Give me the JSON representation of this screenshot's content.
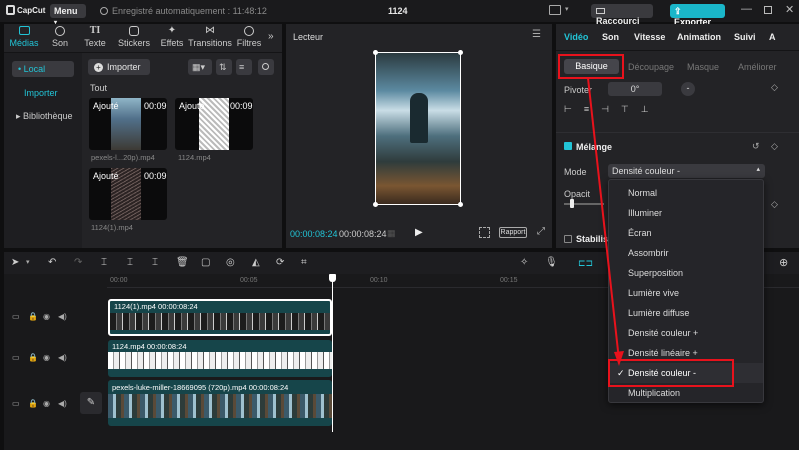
{
  "titlebar": {
    "logo": "CapCut",
    "menu": "Menu",
    "autosave": "Enregistré automatiquement : 11:48:12",
    "project": "1124",
    "shortcuts": "Raccourci",
    "export": "Exporter"
  },
  "media_tabs": [
    {
      "label": "Médias",
      "icon": "media-icon",
      "active": true
    },
    {
      "label": "Son",
      "icon": "audio-icon"
    },
    {
      "label": "Texte",
      "icon": "text-icon"
    },
    {
      "label": "Stickers",
      "icon": "sticker-icon"
    },
    {
      "label": "Effets",
      "icon": "effects-icon"
    },
    {
      "label": "Transitions",
      "icon": "transition-icon"
    },
    {
      "label": "Filtres",
      "icon": "filter-icon"
    }
  ],
  "media_side": {
    "local": "• Local",
    "import": "Importer",
    "library": "▸ Bibliothèque"
  },
  "media_toolbar": {
    "import": "Importer"
  },
  "media_filter": "Tout",
  "media_items": [
    {
      "badge": "Ajouté",
      "duration": "00:09",
      "name": "pexels-l...20p).mp4"
    },
    {
      "badge": "Ajouté",
      "duration": "00:09",
      "name": "1124.mp4"
    },
    {
      "badge": "Ajouté",
      "duration": "00:09",
      "name": "1124(1).mp4"
    }
  ],
  "player": {
    "title": "Lecteur",
    "time_current": "00:00:08:24",
    "time_total": "00:00:08:24",
    "ratio": "Rapport"
  },
  "inspector": {
    "tabs": [
      "Vidéo",
      "Son",
      "Vitesse",
      "Animation",
      "Suivi"
    ],
    "subtabs": [
      "Basique",
      "Découpage",
      "Masque",
      "Améliorer"
    ],
    "rotate_label": "Pivoter",
    "rotate_value": "0°",
    "rotate_minus": "-",
    "blend_label": "Mélange",
    "mode_label": "Mode",
    "mode_value": "Densité couleur -",
    "opacity_label": "Opacit",
    "stabilize_label": "Stabilise"
  },
  "blend_options": [
    "Normal",
    "Illuminer",
    "Écran",
    "Assombrir",
    "Superposition",
    "Lumière vive",
    "Lumière diffuse",
    "Densité couleur +",
    "Densité linéaire +",
    "Densité couleur -",
    "Multiplication"
  ],
  "blend_selected_index": 9,
  "ruler": [
    "00:00",
    "00:05",
    "00:10",
    "00:15"
  ],
  "tracks": [
    {
      "clip_label": "1124(1).mp4  00:00:08:24"
    },
    {
      "clip_label": "1124.mp4  00:00:08:24"
    },
    {
      "clip_label": "pexels-luke-miller-18669095 (720p).mp4  00:00:08:24"
    }
  ],
  "colors": {
    "accent": "#22c4d6",
    "highlight": "#e8121c",
    "export": "#1ab6c9"
  }
}
